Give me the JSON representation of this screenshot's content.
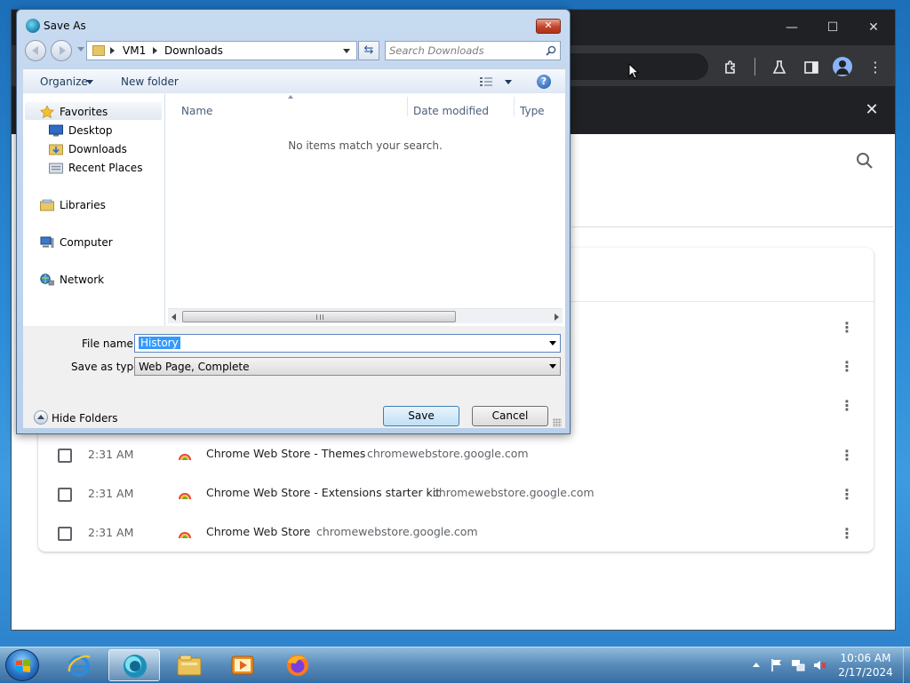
{
  "dialog": {
    "title": "Save As",
    "breadcrumb": [
      "VM1",
      "Downloads"
    ],
    "search_placeholder": "Search Downloads",
    "toolbar": {
      "organize": "Organize",
      "new_folder": "New folder"
    },
    "nav": {
      "favorites": "Favorites",
      "favorites_items": [
        "Desktop",
        "Downloads",
        "Recent Places"
      ],
      "libraries": "Libraries",
      "computer": "Computer",
      "network": "Network"
    },
    "columns": [
      "Name",
      "Date modified",
      "Type"
    ],
    "empty_message": "No items match your search.",
    "file_name_label": "File name:",
    "file_name_value": "History",
    "save_as_type_label": "Save as type:",
    "save_as_type_value": "Web Page, Complete",
    "hide_folders": "Hide Folders",
    "save_button": "Save",
    "cancel_button": "Cancel"
  },
  "history": {
    "rows": [
      {
        "time": "2:31 AM",
        "title": "Chrome Web Store - Themes",
        "domain": "chromewebstore.google.com"
      },
      {
        "time": "2:31 AM",
        "title": "Chrome Web Store - Extensions starter kit",
        "domain": "chromewebstore.google.com"
      },
      {
        "time": "2:31 AM",
        "title": "Chrome Web Store",
        "domain": "chromewebstore.google.com"
      }
    ]
  },
  "taskbar": {
    "apps": [
      "internet-explorer-icon",
      "chrome-app-icon",
      "file-explorer-icon",
      "media-player-icon",
      "firefox-icon"
    ],
    "clock_time": "10:06 AM",
    "clock_date": "2/17/2024"
  },
  "colors": {
    "chrome_dark": "#202124",
    "dialog_frame": "#c7daf0",
    "selection": "#3399ff",
    "taskbar": "#5a8cb9"
  }
}
